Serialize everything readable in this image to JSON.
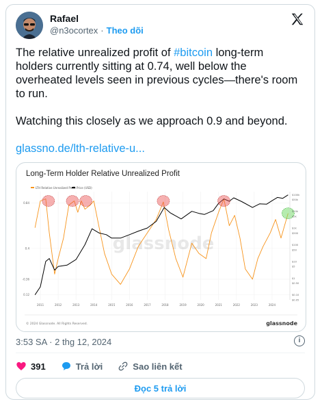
{
  "author": {
    "name": "Rafael",
    "handle": "@n3ocortex",
    "separator": "·",
    "follow_label": "Theo dõi"
  },
  "tweet": {
    "text_part1": "The relative unrealized profit of ",
    "hashtag": "#bitcoin",
    "text_part2": " long-term holders currently sitting at 0.74, well below the overheated levels seen in previous cycles—there's room to run.",
    "paragraph2": "Watching this closely as we approach 0.9 and beyond.",
    "link": "glassno.de/lth-relative-u..."
  },
  "chart": {
    "title": "Long-Term Holder Relative Unrealized Profit",
    "legend_rup": "LTH Relative Unrealized Profit",
    "legend_price": "Price (USD)",
    "watermark": "glassnode",
    "copyright": "© 2024 Glassnode. All Rights Reserved.",
    "brand": "glassnode"
  },
  "chart_data": {
    "type": "line",
    "title": "Long-Term Holder Relative Unrealized Profit",
    "x_ticks": [
      "2011",
      "2012",
      "2013",
      "2014",
      "2015",
      "2016",
      "2017",
      "2018",
      "2019",
      "2020",
      "2021",
      "2022",
      "2023",
      "2024"
    ],
    "y_left_ticks": [
      "0.84",
      "0.4",
      "-0.36",
      "0.12"
    ],
    "y_right_ticks": [
      "$100k",
      "$50k",
      "$10k",
      "$5k",
      "$1k",
      "$500",
      "$100",
      "$50",
      "$10",
      "$5",
      "$1",
      "$0.50",
      "$0.10",
      "$0.05"
    ],
    "series": [
      {
        "name": "LTH Relative Unrealized Profit",
        "color": "#f7931a",
        "x": [
          2010.7,
          2011.0,
          2011.3,
          2011.5,
          2011.8,
          2012.0,
          2012.3,
          2012.6,
          2012.9,
          2013.1,
          2013.3,
          2013.5,
          2013.8,
          2014.0,
          2014.3,
          2014.6,
          2015.0,
          2015.5,
          2016.0,
          2016.5,
          2017.0,
          2017.5,
          2017.9,
          2018.2,
          2018.6,
          2019.0,
          2019.5,
          2019.9,
          2020.3,
          2020.6,
          2021.0,
          2021.3,
          2021.6,
          2021.9,
          2022.2,
          2022.5,
          2022.9,
          2023.2,
          2023.5,
          2023.9,
          2024.2,
          2024.5,
          2024.9
        ],
        "values": [
          0.6,
          0.86,
          0.88,
          0.55,
          0.15,
          0.3,
          0.5,
          0.82,
          0.86,
          0.75,
          0.86,
          0.78,
          0.82,
          0.86,
          0.6,
          0.35,
          0.15,
          0.05,
          0.2,
          0.42,
          0.55,
          0.68,
          0.85,
          0.58,
          0.3,
          0.12,
          0.45,
          0.35,
          0.3,
          0.55,
          0.75,
          0.88,
          0.62,
          0.72,
          0.5,
          0.2,
          0.1,
          0.3,
          0.42,
          0.55,
          0.68,
          0.5,
          0.74
        ]
      },
      {
        "name": "Price (USD)",
        "color": "#000000",
        "x": [
          2010.7,
          2011.0,
          2011.3,
          2011.5,
          2011.8,
          2012.0,
          2012.5,
          2013.0,
          2013.5,
          2013.9,
          2014.3,
          2014.7,
          2015.0,
          2015.5,
          2016.0,
          2016.5,
          2017.0,
          2017.5,
          2017.95,
          2018.3,
          2018.9,
          2019.5,
          2019.9,
          2020.2,
          2020.7,
          2021.0,
          2021.3,
          2021.6,
          2021.85,
          2022.3,
          2022.9,
          2023.3,
          2023.7,
          2024.0,
          2024.3,
          2024.6,
          2024.9
        ],
        "values": [
          0.1,
          0.3,
          10,
          15,
          3,
          5,
          6,
          13,
          100,
          900,
          500,
          400,
          250,
          250,
          400,
          650,
          1000,
          2500,
          17000,
          8000,
          3500,
          10000,
          7500,
          6500,
          11000,
          30000,
          55000,
          40000,
          64000,
          38000,
          17000,
          28000,
          27000,
          43000,
          68000,
          60000,
          96000
        ]
      }
    ],
    "highlights": [
      {
        "x": 2011.45,
        "y": 0.86,
        "color": "red"
      },
      {
        "x": 2012.8,
        "y": 0.86,
        "color": "red"
      },
      {
        "x": 2013.55,
        "y": 0.86,
        "color": "red"
      },
      {
        "x": 2017.9,
        "y": 0.86,
        "color": "red"
      },
      {
        "x": 2021.3,
        "y": 0.86,
        "color": "red"
      },
      {
        "x": 2024.9,
        "y": 0.74,
        "color": "green"
      }
    ]
  },
  "meta": {
    "time": "3:53 SA",
    "separator": "·",
    "date": "2 thg 12, 2024",
    "likes": "391",
    "reply_label": "Trả lời",
    "copy_link_label": "Sao liên kết",
    "read_replies": "Đọc 5 trả lời"
  }
}
